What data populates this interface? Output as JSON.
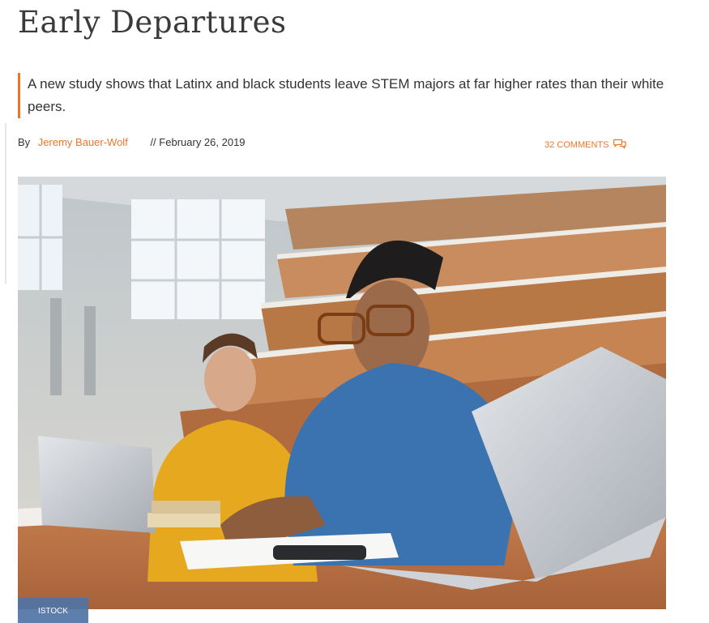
{
  "article": {
    "headline": "Early Departures",
    "deck": "A new study shows that Latinx and black students leave STEM majors at far higher rates than their white peers.",
    "byline": {
      "prefix": "By",
      "author": "Jeremy Bauer-Wolf",
      "date_separator": "//",
      "date": "February 26, 2019"
    },
    "comments_label": "32 COMMENTS",
    "image": {
      "credit": "ISTOCK"
    }
  },
  "colors": {
    "accent": "#e8772e",
    "credit_bg": "#5073a5",
    "headline": "#3a3a3a"
  },
  "icons": {
    "comments": "speech-bubbles-icon"
  }
}
